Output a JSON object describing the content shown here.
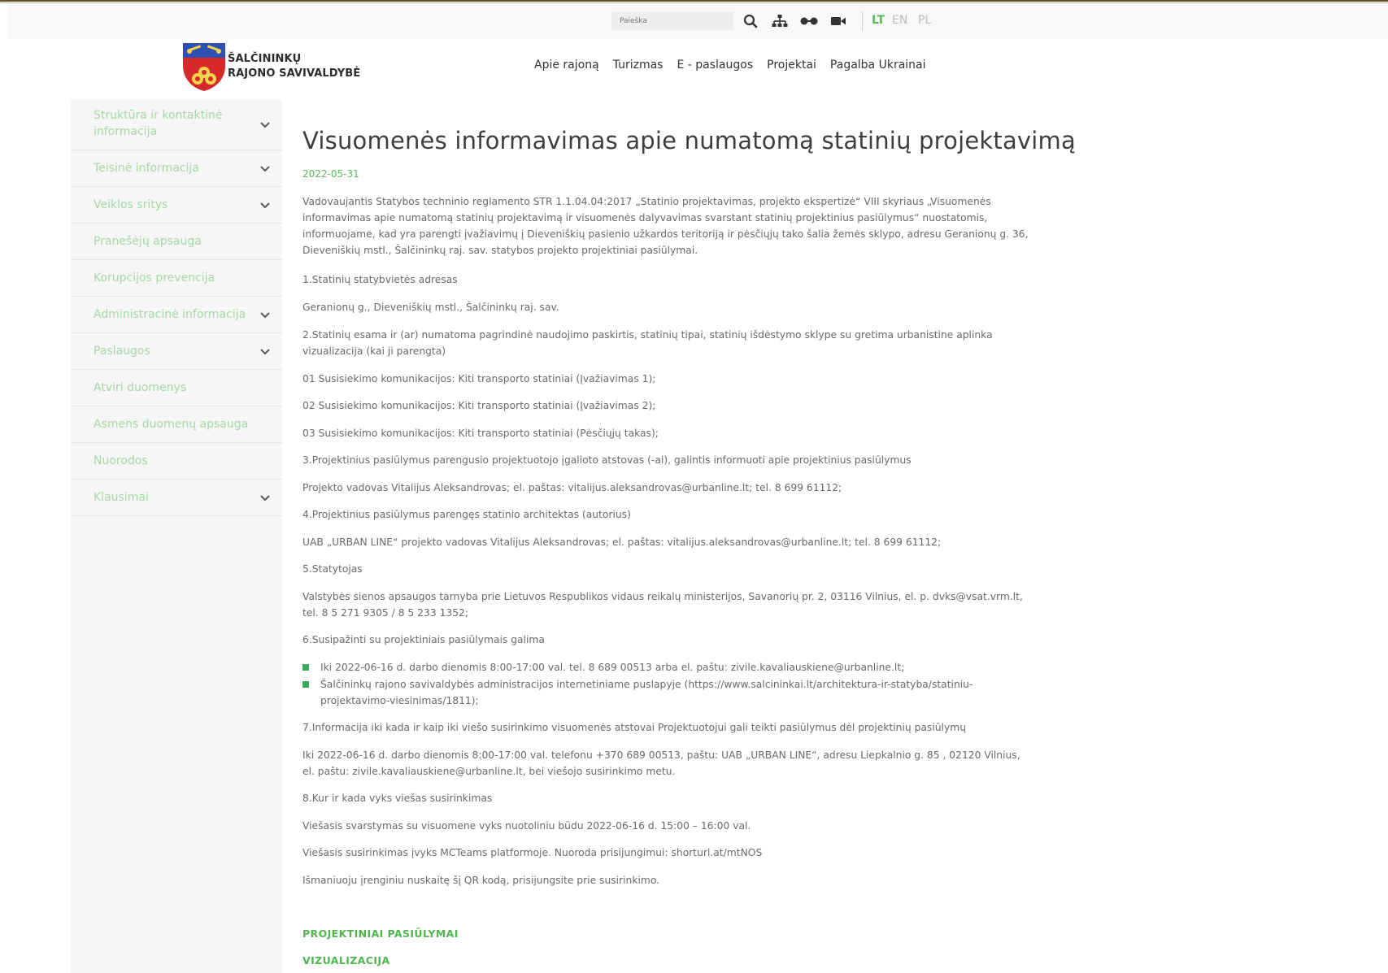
{
  "topbar": {
    "search_placeholder": "Paieška",
    "languages": [
      "LT",
      "EN",
      "PL"
    ],
    "active_language": "LT",
    "icons": [
      "search-icon",
      "sitemap-icon",
      "accessibility-icon",
      "video-icon"
    ]
  },
  "header": {
    "brand_line1": "ŠALČININKŲ",
    "brand_line2": "RAJONO SAVIVALDYBĖ",
    "nav": [
      "Apie rajoną",
      "Turizmas",
      "E - paslaugos",
      "Projektai",
      "Pagalba Ukrainai"
    ]
  },
  "sidebar": {
    "items": [
      {
        "label": "Struktūra ir kontaktinė informacija",
        "has_chevron": true
      },
      {
        "label": "Teisinė informacija",
        "has_chevron": true
      },
      {
        "label": "Veiklos sritys",
        "has_chevron": true
      },
      {
        "label": "Pranešėjų apsauga",
        "has_chevron": false
      },
      {
        "label": "Korupcijos prevencija",
        "has_chevron": false
      },
      {
        "label": "Administracinė informacija",
        "has_chevron": true
      },
      {
        "label": "Paslaugos",
        "has_chevron": true
      },
      {
        "label": "Atviri duomenys",
        "has_chevron": false
      },
      {
        "label": "Asmens duomenų apsauga",
        "has_chevron": false
      },
      {
        "label": "Nuorodos",
        "has_chevron": false
      },
      {
        "label": "Klausimai",
        "has_chevron": true
      }
    ]
  },
  "article": {
    "title": "Visuomenės informavimas apie numatomą statinių projektavimą",
    "date": "2022-05-31",
    "p_intro": "Vadovaujantis Statybos techninio reglamento STR 1.1.04.04:2017 „Statinio projektavimas, projekto ekspertizė“ VIII skyriaus „Visuomenės informavimas apie numatomą statinių projektavimą ir visuomenės dalyvavimas svarstant statinių projektinius pasiūlymus“ nuostatomis, informuojame, kad yra parengti įvažiavimų į Dieveniškių pasienio užkardos teritoriją ir pėsčiųjų tako šalia žemės sklypo, adresu Geranionų g. 36, Dieveniškių mstl., Šalčininkų raj. sav. statybos projekto projektiniai pasiūlymai.",
    "p1": "1.Statinių statybvietės adresas",
    "p2": "Geranionų g., Dieveniškių mstl., Šalčininkų raj. sav.",
    "p3": "2.Statinių esama ir (ar) numatoma pagrindinė naudojimo paskirtis, statinių tipai, statinių išdėstymo sklype su gretima urbanistine aplinka vizualizacija (kai ji parengta)",
    "p4": "01 Susisiekimo komunikacijos: Kiti transporto statiniai (Įvažiavimas 1);",
    "p5": "02 Susisiekimo komunikacijos: Kiti transporto statiniai (Įvažiavimas 2);",
    "p6": "03 Susisiekimo komunikacijos: Kiti transporto statiniai (Pėsčiųjų takas);",
    "p7": "3.Projektinius pasiūlymus parengusio projektuotojo įgalioto atstovas (-ai), galintis informuoti apie projektinius pasiūlymus",
    "p8": "Projekto vadovas Vitalijus Aleksandrovas; el. paštas: vitalijus.aleksandrovas@urbanline.lt; tel. 8 699 61112;",
    "p9": "4.Projektinius pasiūlymus parengęs statinio architektas (autorius)",
    "p10": "UAB „URBAN LINE“ projekto vadovas Vitalijus Aleksandrovas; el. paštas: vitalijus.aleksandrovas@urbanline.lt; tel. 8 699 61112;",
    "p11": "5.Statytojas",
    "p12": "Valstybės sienos apsaugos tarnyba prie Lietuvos Respublikos vidaus reikalų ministerijos, Savanorių pr. 2, 03116 Vilnius, el. p. dvks@vsat.vrm.lt, tel. 8 5 271 9305 / 8 5 233 1352;",
    "p13": "6.Susipažinti su projektiniais pasiūlymais galima",
    "b1": "Iki 2022-06-16 d. darbo dienomis 8:00-17:00 val. tel. 8 689 00513 arba el. paštu: zivile.kavaliauskiene@urbanline.lt;",
    "b2": "Šalčininkų rajono savivaldybės administracijos internetiniame puslapyje (https://www.salcininkai.lt/architektura-ir-statyba/statiniu-projektavimo-viesinimas/1811);",
    "p14": "7.Informacija iki kada ir kaip iki viešo susirinkimo visuomenės atstovai Projektuotojui gali teikti pasiūlymus dėl projektinių pasiūlymų",
    "p15": "Iki 2022-06-16 d. darbo dienomis 8:00-17:00 val. telefonu +370 689 00513, paštu: UAB „URBAN LINE“, adresu Liepkalnio g. 85 , 02120 Vilnius, el. paštu: zivile.kavaliauskiene@urbanline.lt, bei viešojo susirinkimo metu.",
    "p16": "8.Kur ir kada vyks viešas susirinkimas",
    "p17": "Viešasis svarstymas su visuomene vyks nuotoliniu būdu 2022-06-16 d. 15:00 – 16:00 val.",
    "p18": "Viešasis susirinkimas įvyks MCTeams platformoje. Nuoroda prisijungimui: shorturl.at/mtNOS",
    "p19": "Išmaniuoju įrenginiu nuskaitę šį QR kodą, prisijungsite prie susirinkimo.",
    "h1": "PROJEKTINIAI PASIŪLYMAI",
    "h2": "VIZUALIZACIJA"
  },
  "colors": {
    "accent_green": "#5bb85b",
    "sidebar_text": "#a6d8a6",
    "bullet_green": "#3aa85a"
  }
}
